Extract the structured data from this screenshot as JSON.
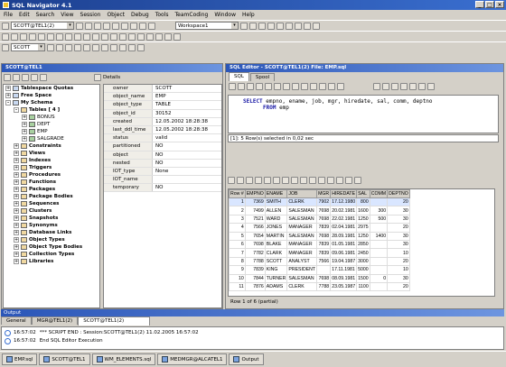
{
  "window": {
    "title": "SQL Navigator 4.1"
  },
  "menu": [
    "File",
    "Edit",
    "Search",
    "View",
    "Session",
    "Object",
    "Debug",
    "Tools",
    "TeamCoding",
    "Window",
    "Help"
  ],
  "toolbar": {
    "session_combo": "SCOTT@TEL1(2)",
    "workspace_combo": "Workspace1",
    "schema_combo": "SCOTT"
  },
  "db_explorer": {
    "title": "SCOTT@TEL1",
    "details_tab": "Details",
    "tree": [
      {
        "label": "Tablespace Quotas",
        "level": 0,
        "toggle": "+"
      },
      {
        "label": "Free Space",
        "level": 0,
        "toggle": "+"
      },
      {
        "label": "My Schema",
        "level": 0,
        "toggle": "-"
      },
      {
        "label": "Tables [ 4 ]",
        "level": 1,
        "toggle": "-"
      },
      {
        "label": "BONUS",
        "level": 2,
        "toggle": "+"
      },
      {
        "label": "DEPT",
        "level": 2,
        "toggle": "+"
      },
      {
        "label": "EMP",
        "level": 2,
        "toggle": "+"
      },
      {
        "label": "SALGRADE",
        "level": 2,
        "toggle": "+"
      },
      {
        "label": "Constraints",
        "level": 1,
        "toggle": "+"
      },
      {
        "label": "Views",
        "level": 1,
        "toggle": "+"
      },
      {
        "label": "Indexes",
        "level": 1,
        "toggle": "+"
      },
      {
        "label": "Triggers",
        "level": 1,
        "toggle": "+"
      },
      {
        "label": "Procedures",
        "level": 1,
        "toggle": "+"
      },
      {
        "label": "Functions",
        "level": 1,
        "toggle": "+"
      },
      {
        "label": "Packages",
        "level": 1,
        "toggle": "+"
      },
      {
        "label": "Package Bodies",
        "level": 1,
        "toggle": "+"
      },
      {
        "label": "Sequences",
        "level": 1,
        "toggle": "+"
      },
      {
        "label": "Clusters",
        "level": 1,
        "toggle": "+"
      },
      {
        "label": "Snapshots",
        "level": 1,
        "toggle": "+"
      },
      {
        "label": "Synonyms",
        "level": 1,
        "toggle": "+"
      },
      {
        "label": "Database Links",
        "level": 1,
        "toggle": "+"
      },
      {
        "label": "Object Types",
        "level": 1,
        "toggle": "+"
      },
      {
        "label": "Object Type Bodies",
        "level": 1,
        "toggle": "+"
      },
      {
        "label": "Collection Types",
        "level": 1,
        "toggle": "+"
      },
      {
        "label": "Libraries",
        "level": 1,
        "toggle": "+"
      }
    ],
    "properties": [
      [
        "owner",
        "SCOTT"
      ],
      [
        "object_name",
        "EMP"
      ],
      [
        "object_type",
        "TABLE"
      ],
      [
        "object_id",
        "30152"
      ],
      [
        "created",
        "12.05.2002 18:28:38"
      ],
      [
        "last_ddl_time",
        "12.05.2002 18:28:38"
      ],
      [
        "status",
        "valid"
      ],
      [
        "partitioned",
        "NO"
      ],
      [
        "object",
        "NO"
      ],
      [
        "nested",
        "NO"
      ],
      [
        "IOT_type",
        "None"
      ],
      [
        "IOT_name",
        ""
      ],
      [
        "temporary",
        "NO"
      ]
    ]
  },
  "sql_editor": {
    "title": "SQL Editor - SCOTT@TEL1(2) File: EMP.sql",
    "tabs": [
      "SQL",
      "Spool"
    ],
    "line1_kw": "SELECT",
    "line1_rest": " empno, ename, job, mgr, hiredate, sal, comm, deptno",
    "line2_kw": "FROM",
    "line2_rest": " emp",
    "status": "[1]: 5 Row(s) selected in 0,02 sec",
    "rowcount": "Row 1 of 6 (partial)",
    "columns": [
      "Row #",
      "EMPNO",
      "ENAME",
      "JOB",
      "MGR",
      "HIREDATE",
      "SAL",
      "COMM",
      "DEPTNO"
    ],
    "rows": [
      [
        "1",
        "7369",
        "SMITH",
        "CLERK",
        "7902",
        "17.12.1980",
        "800",
        "",
        "20"
      ],
      [
        "2",
        "7499",
        "ALLEN",
        "SALESMAN",
        "7698",
        "20.02.1981",
        "1600",
        "300",
        "30"
      ],
      [
        "3",
        "7521",
        "WARD",
        "SALESMAN",
        "7698",
        "22.02.1981",
        "1250",
        "500",
        "30"
      ],
      [
        "4",
        "7566",
        "JONES",
        "MANAGER",
        "7839",
        "02.04.1981",
        "2975",
        "",
        "20"
      ],
      [
        "5",
        "7654",
        "MARTIN",
        "SALESMAN",
        "7698",
        "28.09.1981",
        "1250",
        "1400",
        "30"
      ],
      [
        "6",
        "7698",
        "BLAKE",
        "MANAGER",
        "7839",
        "01.05.1981",
        "2850",
        "",
        "30"
      ],
      [
        "7",
        "7782",
        "CLARK",
        "MANAGER",
        "7839",
        "09.06.1981",
        "2450",
        "",
        "10"
      ],
      [
        "8",
        "7788",
        "SCOTT",
        "ANALYST",
        "7566",
        "19.04.1987",
        "3000",
        "",
        "20"
      ],
      [
        "9",
        "7839",
        "KING",
        "PRESIDENT",
        "",
        "17.11.1981",
        "5000",
        "",
        "10"
      ],
      [
        "10",
        "7844",
        "TURNER",
        "SALESMAN",
        "7698",
        "08.09.1981",
        "1500",
        "0",
        "30"
      ],
      [
        "11",
        "7876",
        "ADAMS",
        "CLERK",
        "7788",
        "23.05.1987",
        "1100",
        "",
        "20"
      ]
    ]
  },
  "output": {
    "title": "Output",
    "tabs": [
      "General",
      "MGR@TEL1(2)",
      "SCOTT@TEL1(2)"
    ],
    "lines": [
      {
        "time": "16:57:02",
        "text": "*** SCRIPT END : Session:SCOTT@TEL1(2)  11.02.2005 16:57:02"
      },
      {
        "time": "16:57:02",
        "text": "End SQL Editor Execution"
      }
    ]
  },
  "taskbar": [
    "EMP.sql",
    "SCOTT@TEL1",
    "WM_ELEMENTS.sql",
    "MEDMGR@ALCATEL1",
    "Output"
  ]
}
